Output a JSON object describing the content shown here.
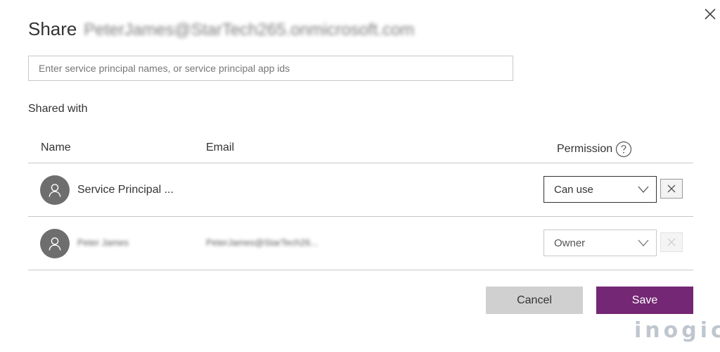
{
  "dialog": {
    "title_prefix": "Share",
    "title_email": "PeterJames@StarTech265.onmicrosoft.com",
    "close_icon": "close-icon"
  },
  "search": {
    "placeholder": "Enter service principal names, or service principal app ids",
    "value": ""
  },
  "shared_with": {
    "title": "Shared with",
    "columns": {
      "name": "Name",
      "email": "Email",
      "permission": "Permission",
      "help_icon": "help-icon"
    },
    "rows": [
      {
        "avatar_icon": "person-icon",
        "name": "Service Principal ...",
        "email": "",
        "permission": "Can use",
        "remove_enabled": true
      },
      {
        "avatar_icon": "person-icon",
        "name": "Peter James",
        "email": "PeterJames@StarTech26...",
        "permission": "Owner",
        "remove_enabled": false
      }
    ]
  },
  "buttons": {
    "cancel": "Cancel",
    "save": "Save"
  },
  "watermark": "inogic",
  "colors": {
    "accent": "#742774",
    "cancel_bg": "#d0d0d0",
    "avatar_bg": "#6e6e6e",
    "border": "#c8c8c8"
  }
}
